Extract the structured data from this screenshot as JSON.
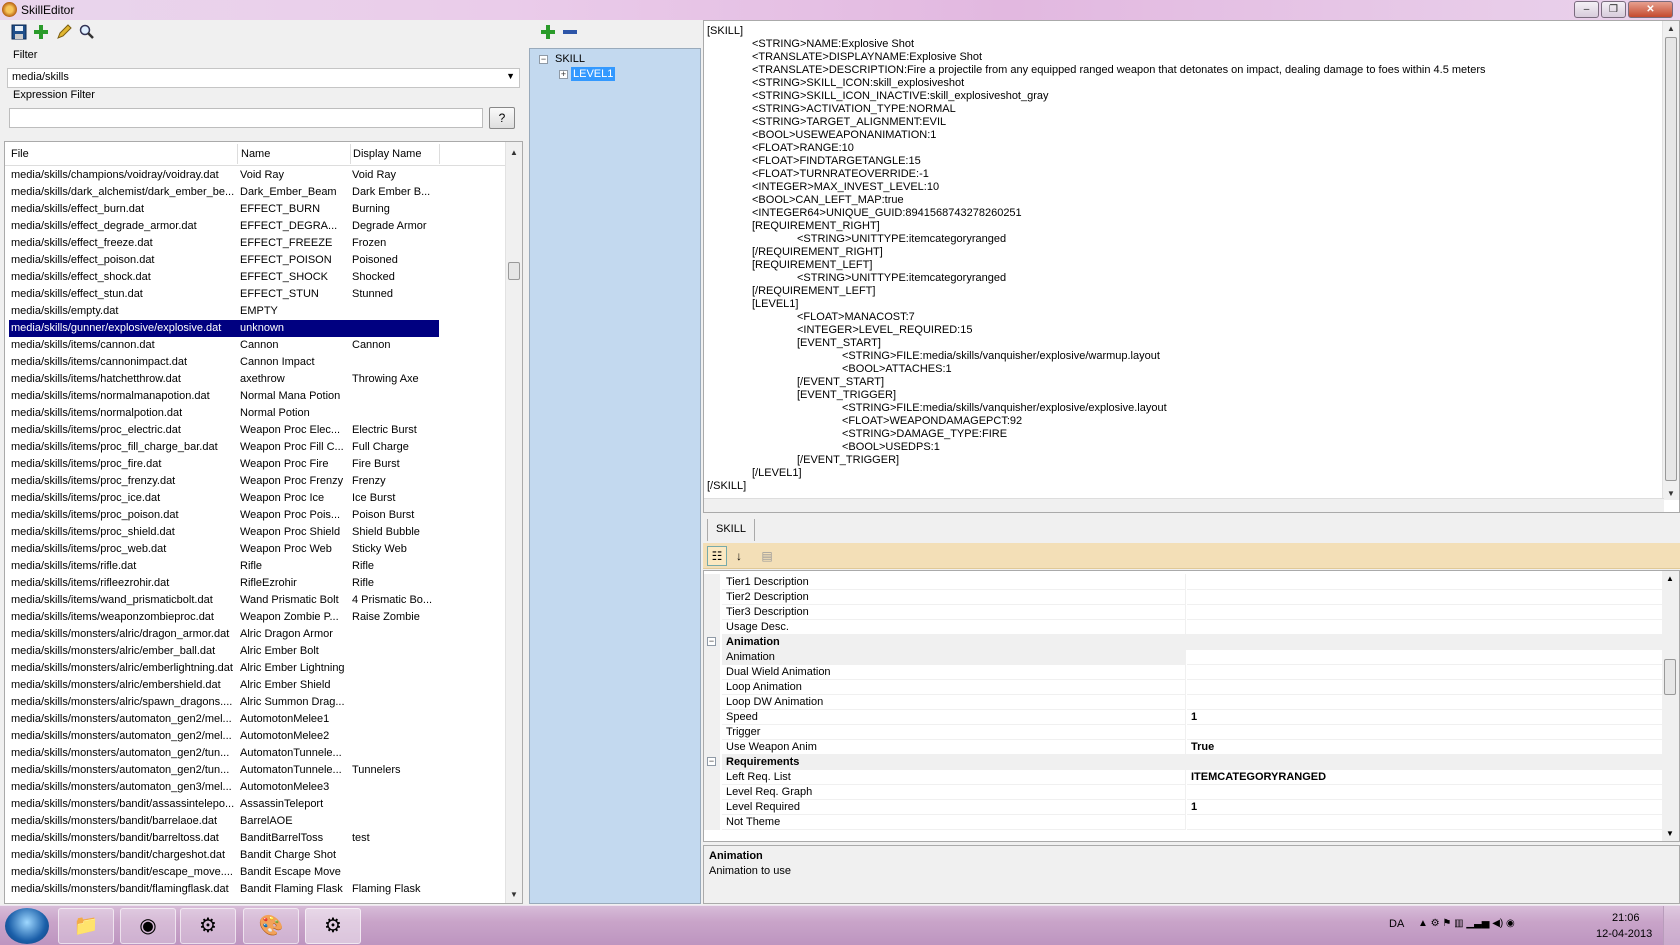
{
  "window": {
    "title": "SkillEditor",
    "minimize": "–",
    "maximize": "❐",
    "close": "✕"
  },
  "left": {
    "filter_label": "Filter",
    "filter_value": "media/skills",
    "expr_label": "Expression Filter",
    "expr_value": "",
    "help_button": "?",
    "columns": [
      "File",
      "Name",
      "Display Name"
    ],
    "rows": [
      [
        "media/skills/champions/voidray/voidray.dat",
        "Void Ray",
        "Void Ray"
      ],
      [
        "media/skills/dark_alchemist/dark_ember_be...",
        "Dark_Ember_Beam",
        "Dark Ember B..."
      ],
      [
        "media/skills/effect_burn.dat",
        "EFFECT_BURN",
        "Burning"
      ],
      [
        "media/skills/effect_degrade_armor.dat",
        "EFFECT_DEGRA...",
        "Degrade Armor"
      ],
      [
        "media/skills/effect_freeze.dat",
        "EFFECT_FREEZE",
        "Frozen"
      ],
      [
        "media/skills/effect_poison.dat",
        "EFFECT_POISON",
        "Poisoned"
      ],
      [
        "media/skills/effect_shock.dat",
        "EFFECT_SHOCK",
        "Shocked"
      ],
      [
        "media/skills/effect_stun.dat",
        "EFFECT_STUN",
        "Stunned"
      ],
      [
        "media/skills/empty.dat",
        "EMPTY",
        ""
      ],
      [
        "media/skills/gunner/explosive/explosive.dat",
        "unknown",
        ""
      ],
      [
        "media/skills/items/cannon.dat",
        "Cannon",
        "Cannon"
      ],
      [
        "media/skills/items/cannonimpact.dat",
        "Cannon Impact",
        ""
      ],
      [
        "media/skills/items/hatchetthrow.dat",
        "axethrow",
        "Throwing Axe"
      ],
      [
        "media/skills/items/normalmanapotion.dat",
        "Normal Mana Potion",
        ""
      ],
      [
        "media/skills/items/normalpotion.dat",
        "Normal Potion",
        ""
      ],
      [
        "media/skills/items/proc_electric.dat",
        "Weapon Proc Elec...",
        "Electric Burst"
      ],
      [
        "media/skills/items/proc_fill_charge_bar.dat",
        "Weapon Proc Fill C...",
        "Full Charge"
      ],
      [
        "media/skills/items/proc_fire.dat",
        "Weapon Proc Fire",
        "Fire Burst"
      ],
      [
        "media/skills/items/proc_frenzy.dat",
        "Weapon Proc Frenzy",
        "Frenzy"
      ],
      [
        "media/skills/items/proc_ice.dat",
        "Weapon Proc Ice",
        "Ice Burst"
      ],
      [
        "media/skills/items/proc_poison.dat",
        "Weapon Proc Pois...",
        "Poison Burst"
      ],
      [
        "media/skills/items/proc_shield.dat",
        "Weapon Proc Shield",
        "Shield Bubble"
      ],
      [
        "media/skills/items/proc_web.dat",
        "Weapon Proc Web",
        "Sticky Web"
      ],
      [
        "media/skills/items/rifle.dat",
        "Rifle",
        "Rifle"
      ],
      [
        "media/skills/items/rifleezrohir.dat",
        "RifleEzrohir",
        "Rifle"
      ],
      [
        "media/skills/items/wand_prismaticbolt.dat",
        "Wand Prismatic Bolt",
        "4 Prismatic Bo..."
      ],
      [
        "media/skills/items/weaponzombieproc.dat",
        "Weapon Zombie P...",
        "Raise Zombie"
      ],
      [
        "media/skills/monsters/alric/dragon_armor.dat",
        "Alric Dragon Armor",
        ""
      ],
      [
        "media/skills/monsters/alric/ember_ball.dat",
        "Alric Ember Bolt",
        ""
      ],
      [
        "media/skills/monsters/alric/emberlightning.dat",
        "Alric Ember Lightning",
        ""
      ],
      [
        "media/skills/monsters/alric/embershield.dat",
        "Alric Ember Shield",
        ""
      ],
      [
        "media/skills/monsters/alric/spawn_dragons....",
        "Alric Summon Drag...",
        ""
      ],
      [
        "media/skills/monsters/automaton_gen2/mel...",
        "AutomotonMelee1",
        ""
      ],
      [
        "media/skills/monsters/automaton_gen2/mel...",
        "AutomotonMelee2",
        ""
      ],
      [
        "media/skills/monsters/automaton_gen2/tun...",
        "AutomatonTunnele...",
        ""
      ],
      [
        "media/skills/monsters/automaton_gen2/tun...",
        "AutomatonTunnele...",
        "Tunnelers"
      ],
      [
        "media/skills/monsters/automaton_gen3/mel...",
        "AutomotonMelee3",
        ""
      ],
      [
        "media/skills/monsters/bandit/assassintelepo...",
        "AssassinTeleport",
        ""
      ],
      [
        "media/skills/monsters/bandit/barrelaoe.dat",
        "BarrelAOE",
        ""
      ],
      [
        "media/skills/monsters/bandit/barreltoss.dat",
        "BanditBarrelToss",
        "test"
      ],
      [
        "media/skills/monsters/bandit/chargeshot.dat",
        "Bandit Charge Shot",
        ""
      ],
      [
        "media/skills/monsters/bandit/escape_move....",
        "Bandit Escape Move",
        ""
      ],
      [
        "media/skills/monsters/bandit/flamingflask.dat",
        "Bandit Flaming Flask",
        "Flaming Flask"
      ]
    ],
    "selected_index": 9
  },
  "tree": {
    "root": "SKILL",
    "child": "LEVEL1"
  },
  "code_lines": [
    "[SKILL]",
    "\t<STRING>NAME:Explosive Shot",
    "\t<TRANSLATE>DISPLAYNAME:Explosive Shot",
    "\t<TRANSLATE>DESCRIPTION:Fire a projectile from any equipped ranged weapon that detonates on impact, dealing damage to foes within 4.5 meters",
    "\t<STRING>SKILL_ICON:skill_explosiveshot",
    "\t<STRING>SKILL_ICON_INACTIVE:skill_explosiveshot_gray",
    "\t<STRING>ACTIVATION_TYPE:NORMAL",
    "\t<STRING>TARGET_ALIGNMENT:EVIL",
    "\t<BOOL>USEWEAPONANIMATION:1",
    "\t<FLOAT>RANGE:10",
    "\t<FLOAT>FINDTARGETANGLE:15",
    "\t<FLOAT>TURNRATEOVERRIDE:-1",
    "\t<INTEGER>MAX_INVEST_LEVEL:10",
    "\t<BOOL>CAN_LEFT_MAP:true",
    "\t<INTEGER64>UNIQUE_GUID:8941568743278260251",
    "\t[REQUIREMENT_RIGHT]",
    "\t\t<STRING>UNITTYPE:itemcategoryranged",
    "\t[/REQUIREMENT_RIGHT]",
    "\t[REQUIREMENT_LEFT]",
    "\t\t<STRING>UNITTYPE:itemcategoryranged",
    "\t[/REQUIREMENT_LEFT]",
    "\t[LEVEL1]",
    "\t\t<FLOAT>MANACOST:7",
    "\t\t<INTEGER>LEVEL_REQUIRED:15",
    "\t\t[EVENT_START]",
    "\t\t\t<STRING>FILE:media/skills/vanquisher/explosive/warmup.layout",
    "\t\t\t<BOOL>ATTACHES:1",
    "\t\t[/EVENT_START]",
    "\t\t[EVENT_TRIGGER]",
    "\t\t\t<STRING>FILE:media/skills/vanquisher/explosive/explosive.layout",
    "\t\t\t<FLOAT>WEAPONDAMAGEPCT:92",
    "\t\t\t<STRING>DAMAGE_TYPE:FIRE",
    "\t\t\t<BOOL>USEDPS:1",
    "\t\t[/EVENT_TRIGGER]",
    "\t[/LEVEL1]",
    "[/SKILL]"
  ],
  "tab": "SKILL",
  "props": [
    {
      "kind": "prop",
      "name": "Tier1 Description",
      "value": ""
    },
    {
      "kind": "prop",
      "name": "Tier2 Description",
      "value": ""
    },
    {
      "kind": "prop",
      "name": "Tier3 Description",
      "value": ""
    },
    {
      "kind": "prop",
      "name": "Usage Desc.",
      "value": ""
    },
    {
      "kind": "cat",
      "name": "Animation",
      "value": ""
    },
    {
      "kind": "prop",
      "name": "Animation",
      "value": "",
      "hl": true
    },
    {
      "kind": "prop",
      "name": "Dual Wield Animation",
      "value": ""
    },
    {
      "kind": "prop",
      "name": "Loop Animation",
      "value": ""
    },
    {
      "kind": "prop",
      "name": "Loop DW Animation",
      "value": ""
    },
    {
      "kind": "prop",
      "name": "Speed",
      "value": "1"
    },
    {
      "kind": "prop",
      "name": "Trigger",
      "value": ""
    },
    {
      "kind": "prop",
      "name": "Use Weapon Anim",
      "value": "True"
    },
    {
      "kind": "cat",
      "name": "Requirements",
      "value": ""
    },
    {
      "kind": "prop",
      "name": "Left Req. List",
      "value": "ITEMCATEGORYRANGED"
    },
    {
      "kind": "prop",
      "name": "Level Req. Graph",
      "value": ""
    },
    {
      "kind": "prop",
      "name": "Level Required",
      "value": "1"
    },
    {
      "kind": "prop",
      "name": "Not Theme",
      "value": ""
    }
  ],
  "help": {
    "title": "Animation",
    "desc": "Animation to use"
  },
  "taskbar": {
    "lang": "DA",
    "time": "21:06",
    "date": "12-04-2013"
  }
}
